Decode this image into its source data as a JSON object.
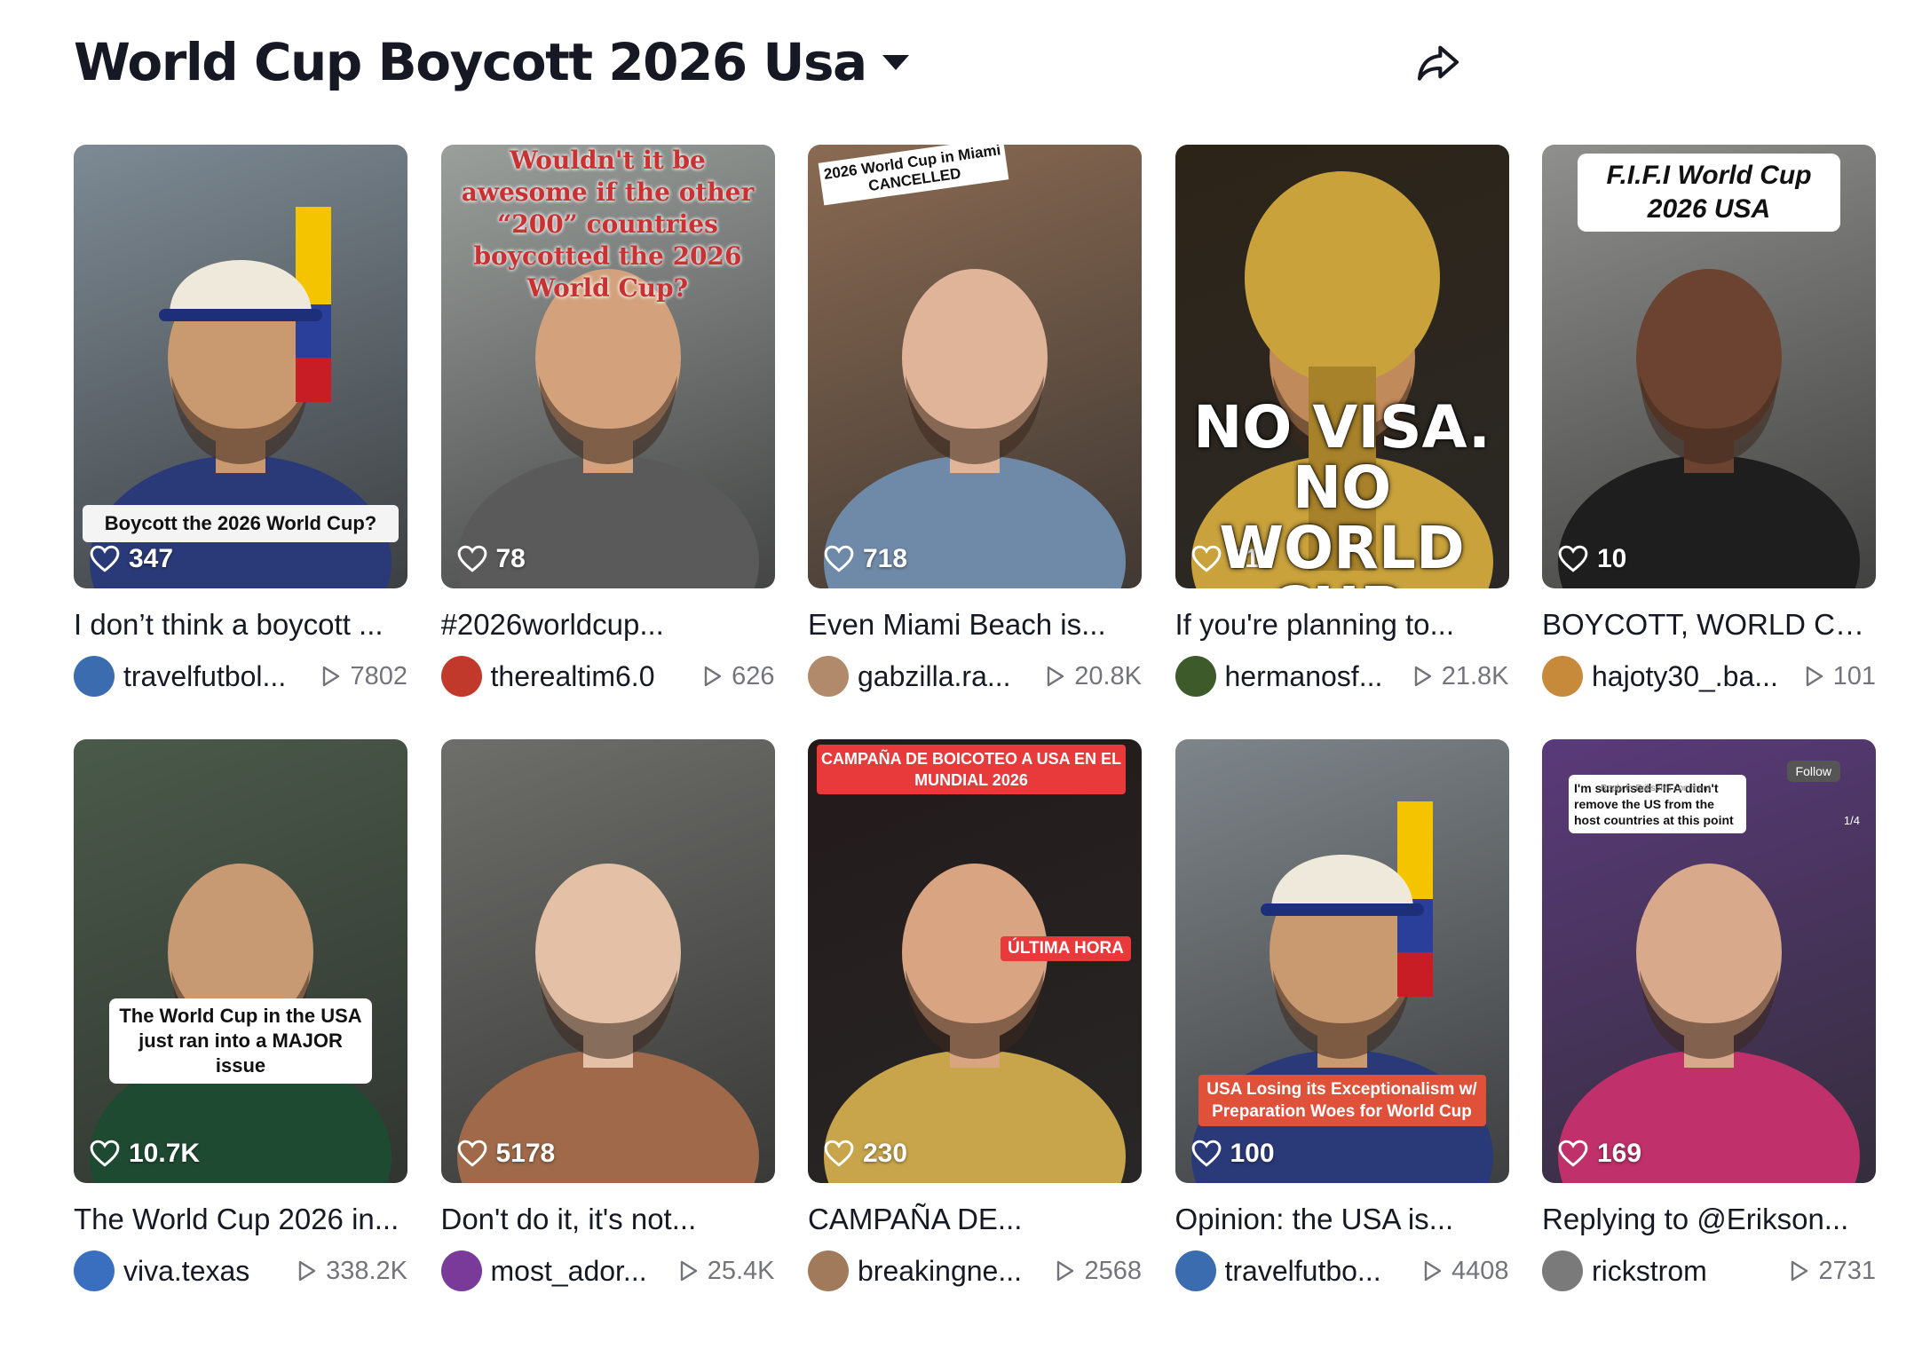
{
  "page": {
    "title": "World Cup Boycott 2026 Usa"
  },
  "cards": [
    {
      "likes": "347",
      "overlay": "Boycott the 2026 World Cup?",
      "caption": "I don’t think a boycott ...",
      "author": "travelfutbol...",
      "views": "7802",
      "bg": "#7d8a94",
      "accent": "#2a3a78",
      "avatar": "#3b6cb0"
    },
    {
      "likes": "78",
      "overlay": "Wouldn't it be awesome if the other “200” countries boycotted the 2026 World Cup?",
      "caption": "#2026worldcup...",
      "author": "therealtim6.0",
      "views": "626",
      "bg": "#9a9f9c",
      "accent": "#5a5a5a",
      "avatar": "#c0392b"
    },
    {
      "likes": "718",
      "overlay": "2026 World Cup in Miami CANCELLED",
      "caption": "Even Miami Beach is...",
      "author": "gabzilla.ra...",
      "views": "20.8K",
      "bg": "#8a6a52",
      "accent": "#6f8aa8",
      "avatar": "#b08a6a"
    },
    {
      "likes": "710",
      "overlay": "NO VISA. NO WORLD CUP.",
      "caption": "If you're planning to...",
      "author": "hermanosf...",
      "views": "21.8K",
      "bg": "#2d2418",
      "accent": "#c9a23c",
      "avatar": "#3d5a2a"
    },
    {
      "likes": "10",
      "overlay": "F.I.F.I World Cup 2026 USA",
      "caption": "BOYCOTT, WORLD CU...",
      "author": "hajoty30_.ba...",
      "views": "101",
      "bg": "#8f8f8d",
      "accent": "#1e1e1e",
      "avatar": "#c68a3a"
    },
    {
      "likes": "10.7K",
      "overlay": "The World Cup in the USA just ran into a MAJOR issue",
      "caption": "The World Cup 2026 in...",
      "author": "viva.texas",
      "views": "338.2K",
      "bg": "#4a5a4a",
      "accent": "#1f4a32",
      "avatar": "#3a6fc0"
    },
    {
      "likes": "5178",
      "overlay": "",
      "caption": "Don't do it, it's not...",
      "author": "most_ador...",
      "views": "25.4K",
      "bg": "#6e6e6a",
      "accent": "#a06a4a",
      "avatar": "#7a3a9a"
    },
    {
      "likes": "230",
      "overlay": "CAMPAÑA DE BOICOTEO A USA EN EL MUNDIAL 2026",
      "overlay2": "ÚLTIMA HORA",
      "caption": "CAMPAÑA DE...",
      "author": "breakingne...",
      "views": "2568",
      "bg": "#231a1a",
      "accent": "#c8a44a",
      "avatar": "#a07a5a"
    },
    {
      "likes": "100",
      "overlay": "USA Losing its Exceptionalism w/ Preparation Woes for World Cup",
      "caption": "Opinion: the USA is...",
      "author": "travelfutbo...",
      "views": "4408",
      "bg": "#7e858a",
      "accent": "#2a3a78",
      "avatar": "#3b6cb0"
    },
    {
      "likes": "169",
      "overlay": "I'm surprised FIFA didn't remove the US from the host countries at this point",
      "overlay_sub": "Reply to Erikson's comment",
      "follow": "Follow",
      "counter": "1/4",
      "caption": "Replying to @Erikson...",
      "author": "rickstrom",
      "views": "2731",
      "bg": "#5a3a7a",
      "accent": "#c0306a",
      "avatar": "#7a7a7a"
    }
  ]
}
